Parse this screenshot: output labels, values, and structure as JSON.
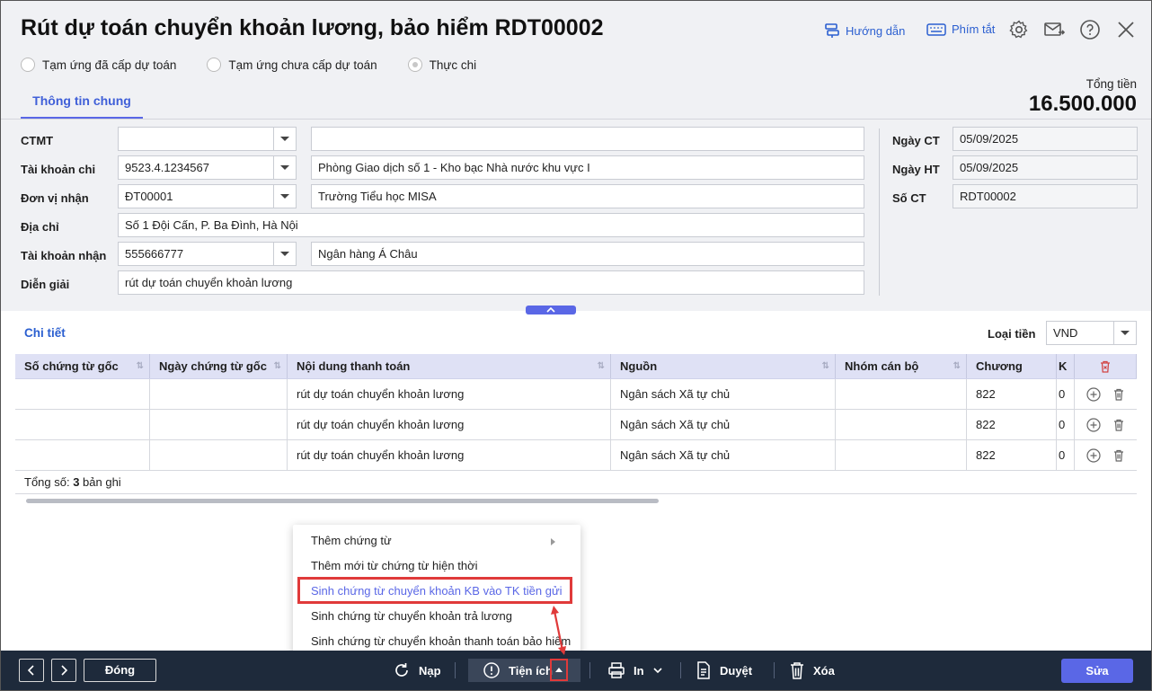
{
  "title": "Rút dự toán chuyển khoản lương, bảo hiểm RDT00002",
  "header_links": {
    "guide": "Hướng dẫn",
    "shortcuts": "Phím tắt"
  },
  "radios": [
    {
      "label": "Tạm ứng đã cấp dự toán",
      "checked": false
    },
    {
      "label": "Tạm ứng chưa cấp dự toán",
      "checked": false
    },
    {
      "label": "Thực chi",
      "checked": true
    }
  ],
  "tab": "Thông tin chung",
  "total": {
    "label": "Tổng tiền",
    "value": "16.500.000"
  },
  "form": {
    "ctmt": {
      "label": "CTMT",
      "value": "",
      "desc": ""
    },
    "tk_chi": {
      "label": "Tài khoản chi",
      "value": "9523.4.1234567",
      "desc": "Phòng Giao dịch số 1 - Kho bạc Nhà nước khu vực I"
    },
    "don_vi": {
      "label": "Đơn vị nhận",
      "value": "ĐT00001",
      "desc": "Trường Tiểu học MISA"
    },
    "dia_chi": {
      "label": "Địa chỉ",
      "value": "Số 1 Đội Cấn, P. Ba Đình, Hà Nội"
    },
    "tk_nhan": {
      "label": "Tài khoản nhận",
      "value": "555666777",
      "desc": "Ngân hàng Á Châu"
    },
    "dien_giai": {
      "label": "Diễn giải",
      "value": "rút dự toán chuyển khoản lương"
    },
    "ngay_ct": {
      "label": "Ngày CT",
      "value": "05/09/2025"
    },
    "ngay_ht": {
      "label": "Ngày HT",
      "value": "05/09/2025"
    },
    "so_ct": {
      "label": "Số CT",
      "value": "RDT00002"
    }
  },
  "detail": {
    "title": "Chi tiết",
    "currency_label": "Loại tiền",
    "currency": "VND",
    "columns": [
      "Số chứng từ gốc",
      "Ngày chứng từ gốc",
      "Nội dung thanh toán",
      "Nguồn",
      "Nhóm cán bộ",
      "Chương",
      "K"
    ],
    "rows": [
      [
        "",
        "",
        "rút dự toán chuyển khoản lương",
        "Ngân sách Xã tự chủ",
        "",
        "822",
        "0"
      ],
      [
        "",
        "",
        "rút dự toán chuyển khoản lương",
        "Ngân sách Xã tự chủ",
        "",
        "822",
        "0"
      ],
      [
        "",
        "",
        "rút dự toán chuyển khoản lương",
        "Ngân sách Xã tự chủ",
        "",
        "822",
        "0"
      ]
    ],
    "footer_prefix": "Tổng số: ",
    "footer_count": "3",
    "footer_suffix": " bản ghi"
  },
  "menu": [
    "Thêm chứng từ",
    "Thêm mới từ chứng từ hiện thời",
    "Sinh chứng từ chuyển khoản KB vào TK tiền gửi",
    "Sinh chứng từ chuyển khoản trả lương",
    "Sinh chứng từ chuyển khoản thanh toán bảo hiểm"
  ],
  "toolbar": {
    "close": "Đóng",
    "reload": "Nạp",
    "utilities": "Tiện ích",
    "print": "In",
    "approve": "Duyệt",
    "delete": "Xóa",
    "edit": "Sửa"
  },
  "colors": {
    "accent": "#5a67e6",
    "link": "#2b5fd0",
    "bar": "#1e2a3b",
    "highlight": "#e03a3a"
  }
}
